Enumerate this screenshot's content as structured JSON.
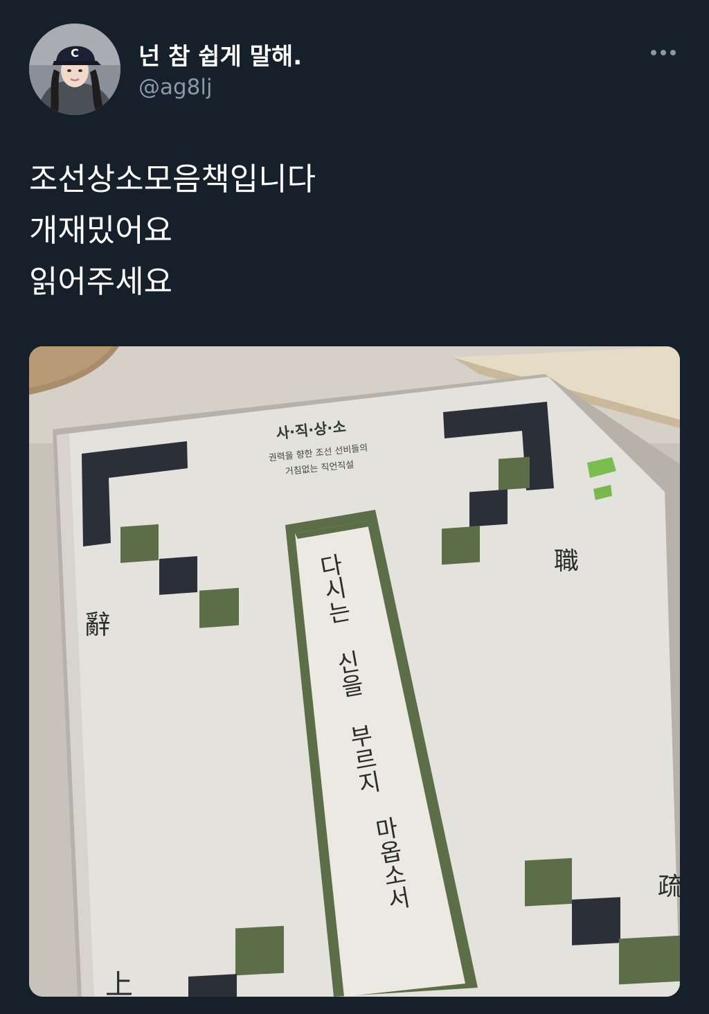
{
  "tweet": {
    "author": {
      "display_name": "넌 참 쉽게 말해.",
      "handle": "@ag8lj",
      "avatar_icon": "profile-photo"
    },
    "more_icon": "more-icon",
    "text_lines": [
      "조선상소모음책입니다",
      "개재밌어요",
      "읽어주세요"
    ]
  },
  "book_cover": {
    "series_title": "사·직·상·소",
    "subtitle_line1": "권력을 향한 조선 선비들의",
    "subtitle_line2": "거침없는 직언직설",
    "main_title_col1": "다시는 신을 부르지",
    "main_title_col2": "마옵소서",
    "hanja_left": "辭",
    "hanja_right": "職",
    "hanja_bottom_right": "疏",
    "hanja_bottom_left": "上"
  },
  "colors": {
    "background": "#15202b",
    "secondary_text": "#8b98a5",
    "cover_green": "#5c6e48",
    "cover_dark": "#2b3038",
    "cover_paper": "#e4e2dc"
  }
}
